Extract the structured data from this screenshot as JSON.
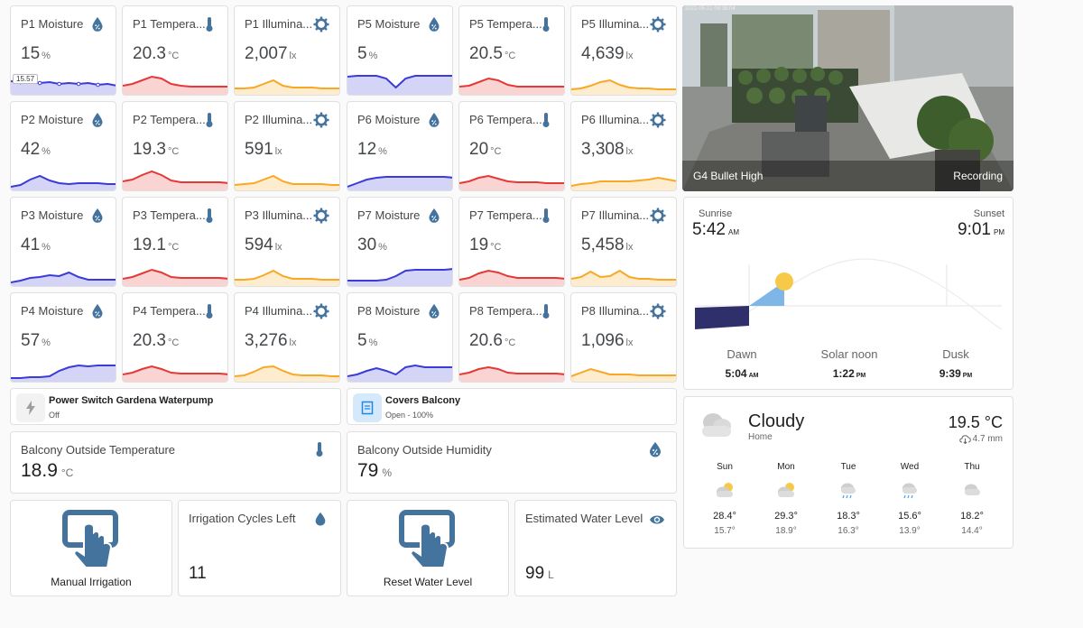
{
  "sensors": [
    {
      "name": "P1 Moisture",
      "value": "15",
      "unit": "%",
      "type": "moisture",
      "chip": "15.57"
    },
    {
      "name": "P1 Tempera...",
      "value": "20.3",
      "unit": "°C",
      "type": "temperature"
    },
    {
      "name": "P1 Illumina...",
      "value": "2,007",
      "unit": "lx",
      "type": "illuminance"
    },
    {
      "name": "P5 Moisture",
      "value": "5",
      "unit": "%",
      "type": "moisture"
    },
    {
      "name": "P5 Tempera...",
      "value": "20.5",
      "unit": "°C",
      "type": "temperature"
    },
    {
      "name": "P5 Illumina...",
      "value": "4,639",
      "unit": "lx",
      "type": "illuminance"
    },
    {
      "name": "P2 Moisture",
      "value": "42",
      "unit": "%",
      "type": "moisture"
    },
    {
      "name": "P2 Tempera...",
      "value": "19.3",
      "unit": "°C",
      "type": "temperature"
    },
    {
      "name": "P2 Illumina...",
      "value": "591",
      "unit": "lx",
      "type": "illuminance"
    },
    {
      "name": "P6 Moisture",
      "value": "12",
      "unit": "%",
      "type": "moisture"
    },
    {
      "name": "P6 Tempera...",
      "value": "20",
      "unit": "°C",
      "type": "temperature"
    },
    {
      "name": "P6 Illumina...",
      "value": "3,308",
      "unit": "lx",
      "type": "illuminance"
    },
    {
      "name": "P3 Moisture",
      "value": "41",
      "unit": "%",
      "type": "moisture"
    },
    {
      "name": "P3 Tempera...",
      "value": "19.1",
      "unit": "°C",
      "type": "temperature"
    },
    {
      "name": "P3 Illumina...",
      "value": "594",
      "unit": "lx",
      "type": "illuminance"
    },
    {
      "name": "P7 Moisture",
      "value": "30",
      "unit": "%",
      "type": "moisture"
    },
    {
      "name": "P7 Tempera...",
      "value": "19",
      "unit": "°C",
      "type": "temperature"
    },
    {
      "name": "P7 Illumina...",
      "value": "5,458",
      "unit": "lx",
      "type": "illuminance"
    },
    {
      "name": "P4 Moisture",
      "value": "57",
      "unit": "%",
      "type": "moisture"
    },
    {
      "name": "P4 Tempera...",
      "value": "20.3",
      "unit": "°C",
      "type": "temperature"
    },
    {
      "name": "P4 Illumina...",
      "value": "3,276",
      "unit": "lx",
      "type": "illuminance"
    },
    {
      "name": "P8 Moisture",
      "value": "5",
      "unit": "%",
      "type": "moisture"
    },
    {
      "name": "P8 Tempera...",
      "value": "20.6",
      "unit": "°C",
      "type": "temperature"
    },
    {
      "name": "P8 Illumina...",
      "value": "1,096",
      "unit": "lx",
      "type": "illuminance"
    }
  ],
  "entities": {
    "pump": {
      "name": "Power Switch Gardena Waterpump",
      "state": "Off",
      "icon": "flash-icon"
    },
    "covers": {
      "name": "Covers Balcony",
      "state": "Open - 100%",
      "icon": "window-shutter-icon"
    }
  },
  "balcony": {
    "temp_label": "Balcony Outside Temperature",
    "temp_value": "18.9",
    "temp_unit": "°C",
    "humidity_label": "Balcony Outside Humidity",
    "humidity_value": "79",
    "humidity_unit": "%"
  },
  "irrigation": {
    "manual_label": "Manual Irrigation",
    "cycles_label": "Irrigation Cycles Left",
    "cycles_value": "11",
    "reset_label": "Reset Water Level",
    "water_label": "Estimated Water Level",
    "water_value": "99",
    "water_unit": "L"
  },
  "camera": {
    "timestamp": "2022-05-21 08:38:04",
    "name": "G4 Bullet High",
    "status": "Recording"
  },
  "sun": {
    "sunrise_label": "Sunrise",
    "sunrise_time": "5:42",
    "sunrise_ampm": "AM",
    "sunset_label": "Sunset",
    "sunset_time": "9:01",
    "sunset_ampm": "PM",
    "dawn_label": "Dawn",
    "dawn_time": "5:04",
    "dawn_ampm": "AM",
    "noon_label": "Solar noon",
    "noon_time": "1:22",
    "noon_ampm": "PM",
    "dusk_label": "Dusk",
    "dusk_time": "9:39",
    "dusk_ampm": "PM"
  },
  "weather": {
    "condition": "Cloudy",
    "location": "Home",
    "temperature": "19.5 °C",
    "precipitation": "4.7 mm",
    "forecast": [
      {
        "day": "Sun",
        "hi": "28.4°",
        "lo": "15.7°",
        "icon": "partly-cloudy-icon"
      },
      {
        "day": "Mon",
        "hi": "29.3°",
        "lo": "18.9°",
        "icon": "partly-cloudy-icon"
      },
      {
        "day": "Tue",
        "hi": "18.3°",
        "lo": "16.3°",
        "icon": "rainy-icon"
      },
      {
        "day": "Wed",
        "hi": "15.6°",
        "lo": "13.9°",
        "icon": "rainy-icon"
      },
      {
        "day": "Thu",
        "hi": "18.2°",
        "lo": "14.4°",
        "icon": "cloudy-icon"
      }
    ]
  },
  "colors": {
    "moisture": "#3b3bd8",
    "temperature": "#e53935",
    "illuminance": "#f9a825",
    "icon": "#44739e"
  }
}
